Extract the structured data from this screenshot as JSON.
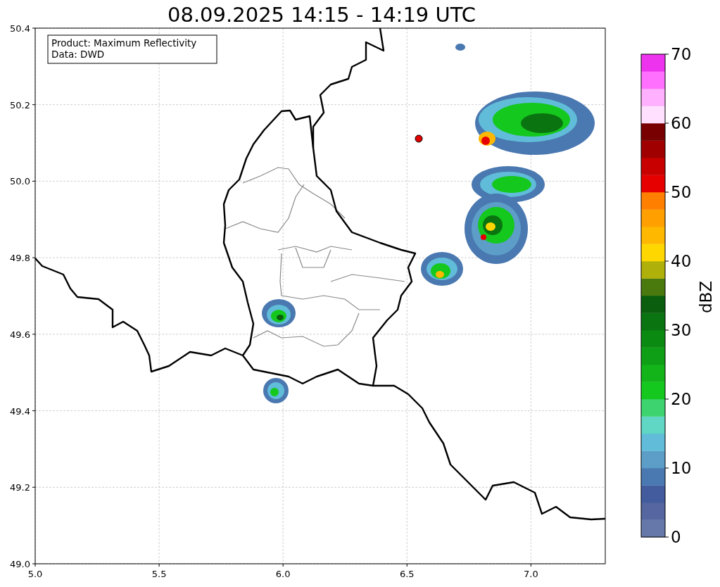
{
  "title": "08.09.2025 14:15 - 14:19 UTC",
  "legend": {
    "lines": [
      "Product: Maximum Reflectivity",
      "Data: DWD"
    ]
  },
  "map": {
    "x_ticks": [
      "5.0",
      "5.5",
      "6.0",
      "6.5",
      "7.0"
    ],
    "y_ticks": [
      "50.4",
      "50.2",
      "50.0",
      "49.8",
      "49.6",
      "49.4",
      "49.2",
      "49.0"
    ]
  },
  "colorbar": {
    "label": "dBZ",
    "ticks": [
      "70",
      "60",
      "50",
      "40",
      "30",
      "20",
      "10",
      "0"
    ],
    "bands": [
      {
        "color": "#6677aa"
      },
      {
        "color": "#5566a0"
      },
      {
        "color": "#425c9e"
      },
      {
        "color": "#4a78b0"
      },
      {
        "color": "#5c9ec8"
      },
      {
        "color": "#60bcd8"
      },
      {
        "color": "#60d6c4"
      },
      {
        "color": "#3dd470"
      },
      {
        "color": "#14c81e"
      },
      {
        "color": "#12b41a"
      },
      {
        "color": "#0f9f16"
      },
      {
        "color": "#0b8a12"
      },
      {
        "color": "#0a7410"
      },
      {
        "color": "#0a5e0e"
      },
      {
        "color": "#4a7a0e"
      },
      {
        "color": "#b0b00a"
      },
      {
        "color": "#ffd700"
      },
      {
        "color": "#ffb800"
      },
      {
        "color": "#ffa000"
      },
      {
        "color": "#ff8000"
      },
      {
        "color": "#e60000"
      },
      {
        "color": "#c80000"
      },
      {
        "color": "#a00000"
      },
      {
        "color": "#780000"
      },
      {
        "color": "#ffe0ff"
      },
      {
        "color": "#ffb0ff"
      },
      {
        "color": "#ff70ff"
      },
      {
        "color": "#ee33ee"
      }
    ]
  }
}
